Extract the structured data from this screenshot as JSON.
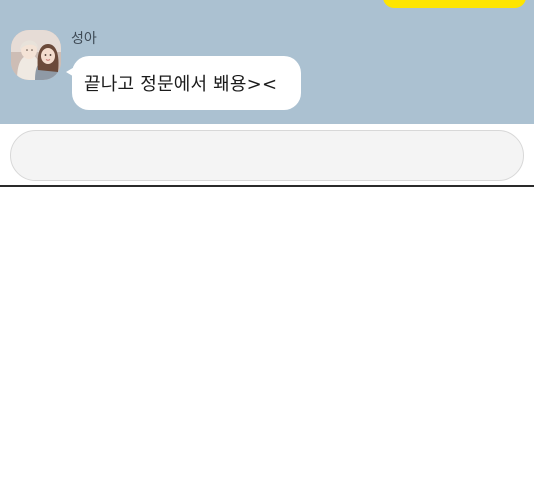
{
  "chat": {
    "sender": "성아",
    "message": "끝나고 정문에서 봬용><"
  },
  "input": {
    "value": "",
    "placeholder": ""
  },
  "colors": {
    "chat_background": "#abc1d1",
    "sent_bubble": "#fee500",
    "received_bubble": "#ffffff"
  }
}
